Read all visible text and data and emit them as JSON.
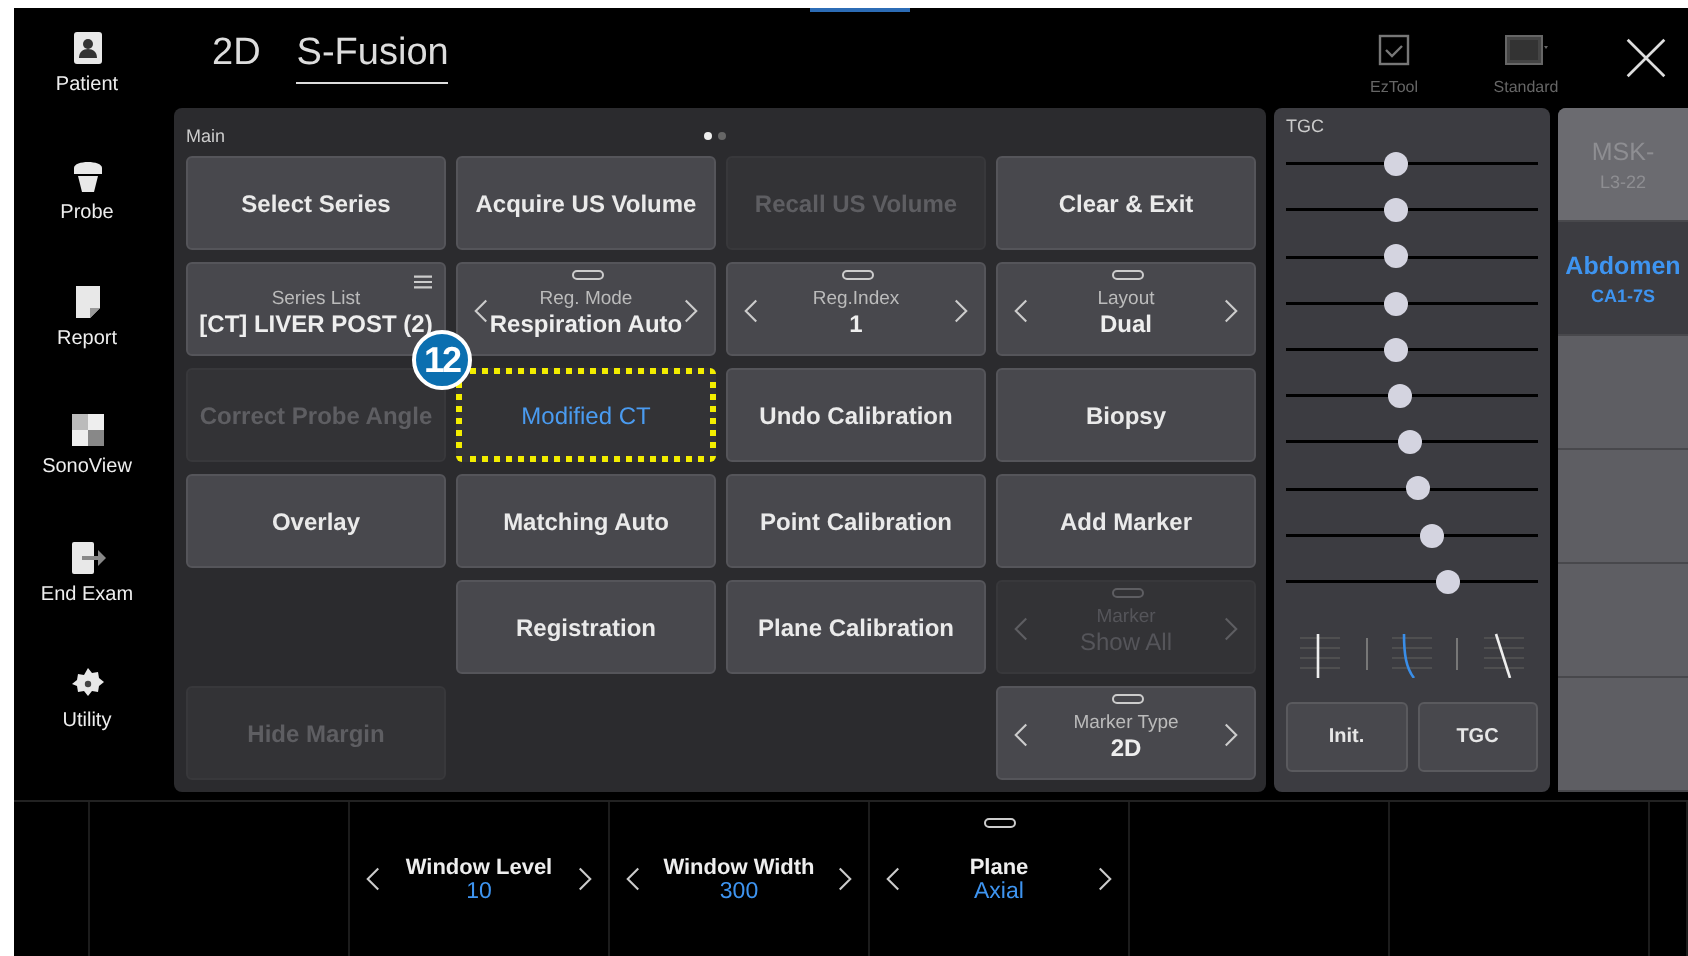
{
  "sidebar": {
    "items": [
      {
        "label": "Patient",
        "kind": "patient"
      },
      {
        "label": "Probe",
        "kind": "probe"
      },
      {
        "label": "Report",
        "kind": "report"
      },
      {
        "label": "SonoView",
        "kind": "sonoview"
      },
      {
        "label": "End Exam",
        "kind": "endexam"
      },
      {
        "label": "Utility",
        "kind": "utility"
      }
    ]
  },
  "header": {
    "modes": [
      {
        "label": "2D",
        "selected": false
      },
      {
        "label": "S-Fusion",
        "selected": true
      }
    ],
    "tools": [
      {
        "label": "EzTool",
        "kind": "checkbox"
      },
      {
        "label": "Standard",
        "kind": "monitor"
      }
    ]
  },
  "main_panel": {
    "title": "Main",
    "pages": [
      {
        "selected": true
      },
      {
        "selected": false
      }
    ],
    "buttons": [
      {
        "kind": "button",
        "label": "Select Series",
        "disabled": false
      },
      {
        "kind": "button",
        "label": "Acquire US Volume",
        "disabled": false
      },
      {
        "kind": "button",
        "label": "Recall US Volume",
        "disabled": true
      },
      {
        "kind": "button",
        "label": "Clear & Exit",
        "disabled": false
      },
      {
        "kind": "selector",
        "title": "Series List",
        "value": "[CT] LIVER POST (2)",
        "arrows": false,
        "menu": true,
        "handle": false,
        "disabled": false
      },
      {
        "kind": "selector",
        "title": "Reg. Mode",
        "value": "Respiration Auto",
        "arrows": true,
        "menu": false,
        "handle": true,
        "disabled": false
      },
      {
        "kind": "selector",
        "title": "Reg.Index",
        "value": "1",
        "arrows": true,
        "menu": false,
        "handle": true,
        "disabled": false
      },
      {
        "kind": "selector",
        "title": "Layout",
        "value": "Dual",
        "arrows": true,
        "menu": false,
        "handle": true,
        "disabled": false
      },
      {
        "kind": "button",
        "label": "Correct Probe Angle",
        "disabled": true
      },
      {
        "kind": "button",
        "label": "Modified CT",
        "disabled": false,
        "selected": true,
        "callout": "12"
      },
      {
        "kind": "button",
        "label": "Undo Calibration",
        "disabled": false
      },
      {
        "kind": "button",
        "label": "Biopsy",
        "disabled": false
      },
      {
        "kind": "button",
        "label": "Overlay",
        "disabled": false
      },
      {
        "kind": "button",
        "label": "Matching Auto",
        "disabled": false
      },
      {
        "kind": "button",
        "label": "Point Calibration",
        "disabled": false
      },
      {
        "kind": "button",
        "label": "Add Marker",
        "disabled": false
      },
      {
        "kind": "empty"
      },
      {
        "kind": "button",
        "label": "Registration",
        "disabled": false
      },
      {
        "kind": "button",
        "label": "Plane Calibration",
        "disabled": false
      },
      {
        "kind": "selector",
        "title": "Marker",
        "value": "Show All",
        "arrows": true,
        "menu": false,
        "handle": true,
        "disabled": true
      },
      {
        "kind": "button",
        "label": "Hide Margin",
        "disabled": true
      },
      {
        "kind": "empty"
      },
      {
        "kind": "empty"
      },
      {
        "kind": "selector",
        "title": "Marker Type",
        "value": "2D",
        "arrows": true,
        "menu": false,
        "handle": true,
        "disabled": false
      }
    ]
  },
  "tgc": {
    "title": "TGC",
    "sliders": [
      {
        "level": 0.44
      },
      {
        "level": 0.44
      },
      {
        "level": 0.44
      },
      {
        "level": 0.44
      },
      {
        "level": 0.44
      },
      {
        "level": 0.45
      },
      {
        "level": 0.49
      },
      {
        "level": 0.52
      },
      {
        "level": 0.58
      },
      {
        "level": 0.64
      }
    ],
    "curves": [
      {
        "kind": "straight",
        "selected": false
      },
      {
        "kind": "curve",
        "selected": true
      },
      {
        "kind": "slant",
        "selected": false
      }
    ],
    "buttons": [
      "Init.",
      "TGC"
    ]
  },
  "probes": [
    {
      "kind": "probe",
      "name": "MSK-",
      "model": "L3-22",
      "selected": false,
      "disabled": true
    },
    {
      "kind": "probe",
      "name": "Abdomen",
      "model": "CA1-7S",
      "selected": true,
      "disabled": false
    },
    {
      "kind": "empty"
    },
    {
      "kind": "empty"
    },
    {
      "kind": "empty"
    },
    {
      "kind": "empty"
    }
  ],
  "bottom_bar": [
    {
      "kind": "empty"
    },
    {
      "kind": "empty"
    },
    {
      "kind": "knob",
      "title": "Window Level",
      "value": "10",
      "handle": false
    },
    {
      "kind": "knob",
      "title": "Window Width",
      "value": "300",
      "handle": false
    },
    {
      "kind": "knob",
      "title": "Plane",
      "value": "Axial",
      "handle": true
    },
    {
      "kind": "empty"
    },
    {
      "kind": "empty"
    },
    {
      "kind": "empty"
    }
  ]
}
